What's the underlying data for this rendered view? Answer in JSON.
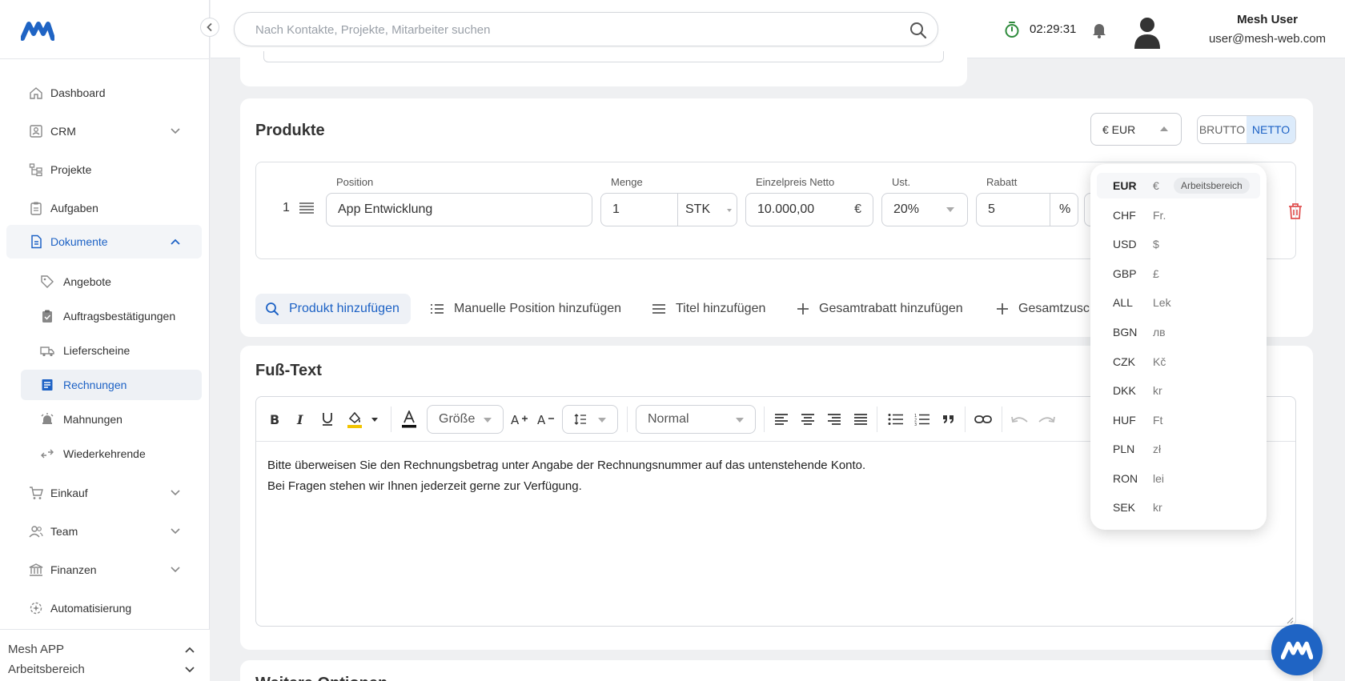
{
  "brand": {
    "accent": "#1d62c5"
  },
  "search": {
    "placeholder": "Nach Kontakte, Projekte, Mitarbeiter suchen"
  },
  "header": {
    "timer": "02:29:31",
    "user_name": "Mesh User",
    "user_email": "user@mesh-web.com"
  },
  "sidebar": {
    "items": [
      {
        "label": "Dashboard",
        "icon": "home-icon"
      },
      {
        "label": "CRM",
        "icon": "contacts-icon"
      },
      {
        "label": "Projekte",
        "icon": "projects-icon"
      },
      {
        "label": "Aufgaben",
        "icon": "clipboard-icon"
      },
      {
        "label": "Dokumente",
        "icon": "document-icon"
      },
      {
        "label": "Einkauf",
        "icon": "cart-icon"
      },
      {
        "label": "Team",
        "icon": "team-icon"
      },
      {
        "label": "Finanzen",
        "icon": "bank-icon"
      },
      {
        "label": "Automatisierung",
        "icon": "automation-icon"
      }
    ],
    "sub_items": [
      {
        "label": "Angebote",
        "icon": "tag-icon"
      },
      {
        "label": "Auftragsbestätigungen",
        "icon": "clipboard-check-icon"
      },
      {
        "label": "Lieferscheine",
        "icon": "truck-icon"
      },
      {
        "label": "Rechnungen",
        "icon": "invoice-icon"
      },
      {
        "label": "Mahnungen",
        "icon": "alarm-icon"
      },
      {
        "label": "Wiederkehrende",
        "icon": "recurring-icon"
      }
    ],
    "footer": {
      "app": "Mesh APP",
      "workspace": "Arbeitsbereich"
    }
  },
  "products": {
    "title": "Produkte",
    "currency_selected": "€ EUR",
    "brutto": "BRUTTO",
    "netto": "NETTO",
    "row": {
      "number": "1",
      "position_label": "Position",
      "position_value": "App Entwicklung",
      "menge_label": "Menge",
      "menge_value": "1",
      "unit_value": "STK",
      "price_label": "Einzelpreis Netto",
      "price_value": "10.000,00",
      "price_symbol": "€",
      "ust_label": "Ust.",
      "ust_value": "20%",
      "rabatt_label": "Rabatt",
      "rabatt_value": "5",
      "rabatt_unit": "%"
    },
    "actions": [
      "Produkt hinzufügen",
      "Manuelle Position hinzufügen",
      "Titel hinzufügen",
      "Gesamtrabatt hinzufügen",
      "Gesamtzusc"
    ]
  },
  "footer_text": {
    "title": "Fuß-Text",
    "size_select": "Größe",
    "style_select": "Normal",
    "line1": "Bitte überweisen Sie den Rechnungsbetrag unter Angabe der Rechnungsnummer auf das untenstehende Konto.",
    "line2": "Bei Fragen stehen wir Ihnen jederzeit gerne zur Verfügung."
  },
  "more_options": {
    "title": "Weitere Optionen"
  },
  "currency_dropdown": {
    "badge": "Arbeitsbereich",
    "options": [
      {
        "code": "EUR",
        "symbol": "€"
      },
      {
        "code": "CHF",
        "symbol": "Fr."
      },
      {
        "code": "USD",
        "symbol": "$"
      },
      {
        "code": "GBP",
        "symbol": "£"
      },
      {
        "code": "ALL",
        "symbol": "Lek"
      },
      {
        "code": "BGN",
        "symbol": "лв"
      },
      {
        "code": "CZK",
        "symbol": "Kč"
      },
      {
        "code": "DKK",
        "symbol": "kr"
      },
      {
        "code": "HUF",
        "symbol": "Ft"
      },
      {
        "code": "PLN",
        "symbol": "zł"
      },
      {
        "code": "RON",
        "symbol": "lei"
      },
      {
        "code": "SEK",
        "symbol": "kr"
      }
    ]
  }
}
